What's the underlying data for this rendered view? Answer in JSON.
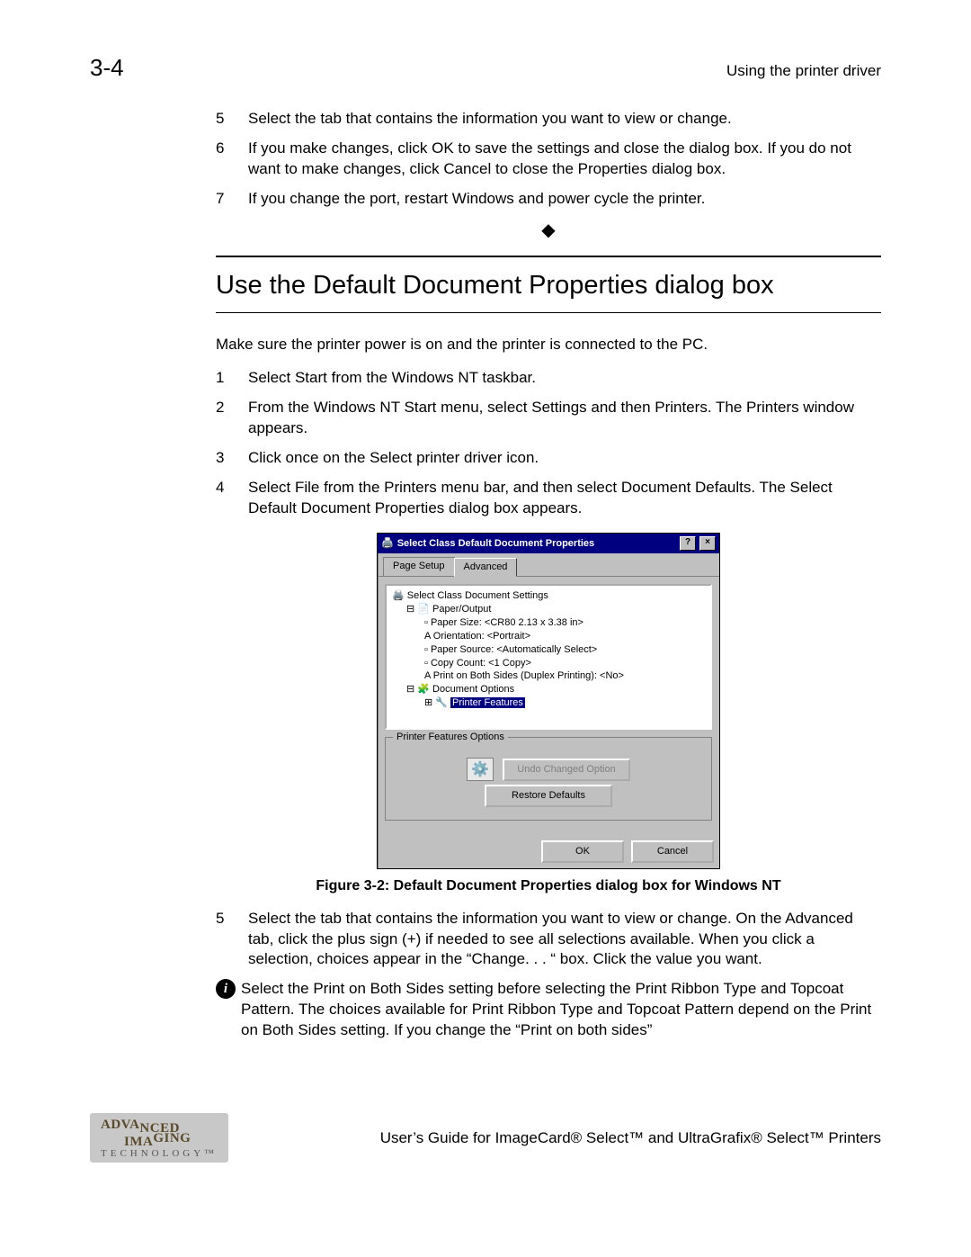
{
  "header": {
    "page_number": "3-4",
    "running_head": "Using the printer driver"
  },
  "top_steps": [
    {
      "n": "5",
      "t": "Select the tab that contains the information you want to view or change."
    },
    {
      "n": "6",
      "t": "If you make changes, click OK to save the settings and close the dialog box. If you do not want to make changes, click Cancel to close the Properties dialog box."
    },
    {
      "n": "7",
      "t": "If you change the port, restart Windows and power cycle the printer."
    }
  ],
  "section_title": "Use the Default Document Properties dialog box",
  "intro": "Make sure the printer power is on and the printer is connected to the PC.",
  "steps": [
    {
      "n": "1",
      "t": "Select Start from the Windows NT taskbar."
    },
    {
      "n": "2",
      "t": "From the Windows NT Start menu, select Settings and then Printers. The Printers window appears."
    },
    {
      "n": "3",
      "t": "Click once on the Select printer driver icon."
    },
    {
      "n": "4",
      "t": "Select File from the Printers menu bar, and then select Document Defaults. The Select Default Document Properties dialog box appears."
    }
  ],
  "dialog": {
    "title": "Select Class Default Document Properties",
    "tabs": [
      "Page Setup",
      "Advanced"
    ],
    "tree": {
      "root": "Select Class Document Settings",
      "paper": "Paper/Output",
      "paper_size": "Paper Size: <CR80 2.13 x 3.38 in>",
      "orientation": "Orientation: <Portrait>",
      "paper_source": "Paper Source: <Automatically Select>",
      "copy_count": "Copy Count: <1 Copy>",
      "duplex": "Print on Both Sides (Duplex Printing): <No>",
      "doc_options": "Document Options",
      "printer_features": "Printer Features"
    },
    "group_label": "Printer Features Options",
    "undo": "Undo Changed Option",
    "restore": "Restore Defaults",
    "ok": "OK",
    "cancel": "Cancel"
  },
  "caption": "Figure 3-2: Default Document Properties dialog box for Windows NT",
  "after_steps": [
    {
      "n": "5",
      "t": "Select the tab that contains the information you want to view or change. On the Advanced tab, click the plus sign (+) if needed to see all selections available. When you click a selection, choices appear in the “Change. . . “ box. Click the value you want."
    }
  ],
  "note": "Select the Print on Both Sides setting before selecting the Print Ribbon Type and Topcoat Pattern. The choices available for Print Ribbon Type and Topcoat Pattern depend on the Print on Both Sides setting. If you change the “Print on both sides”",
  "footer": {
    "logo_top": "ADVANCED IMAGING",
    "logo_bottom": "TECHNOLOGY™",
    "text": "User’s Guide for ImageCard® Select™ and UltraGrafix® Select™ Printers"
  }
}
